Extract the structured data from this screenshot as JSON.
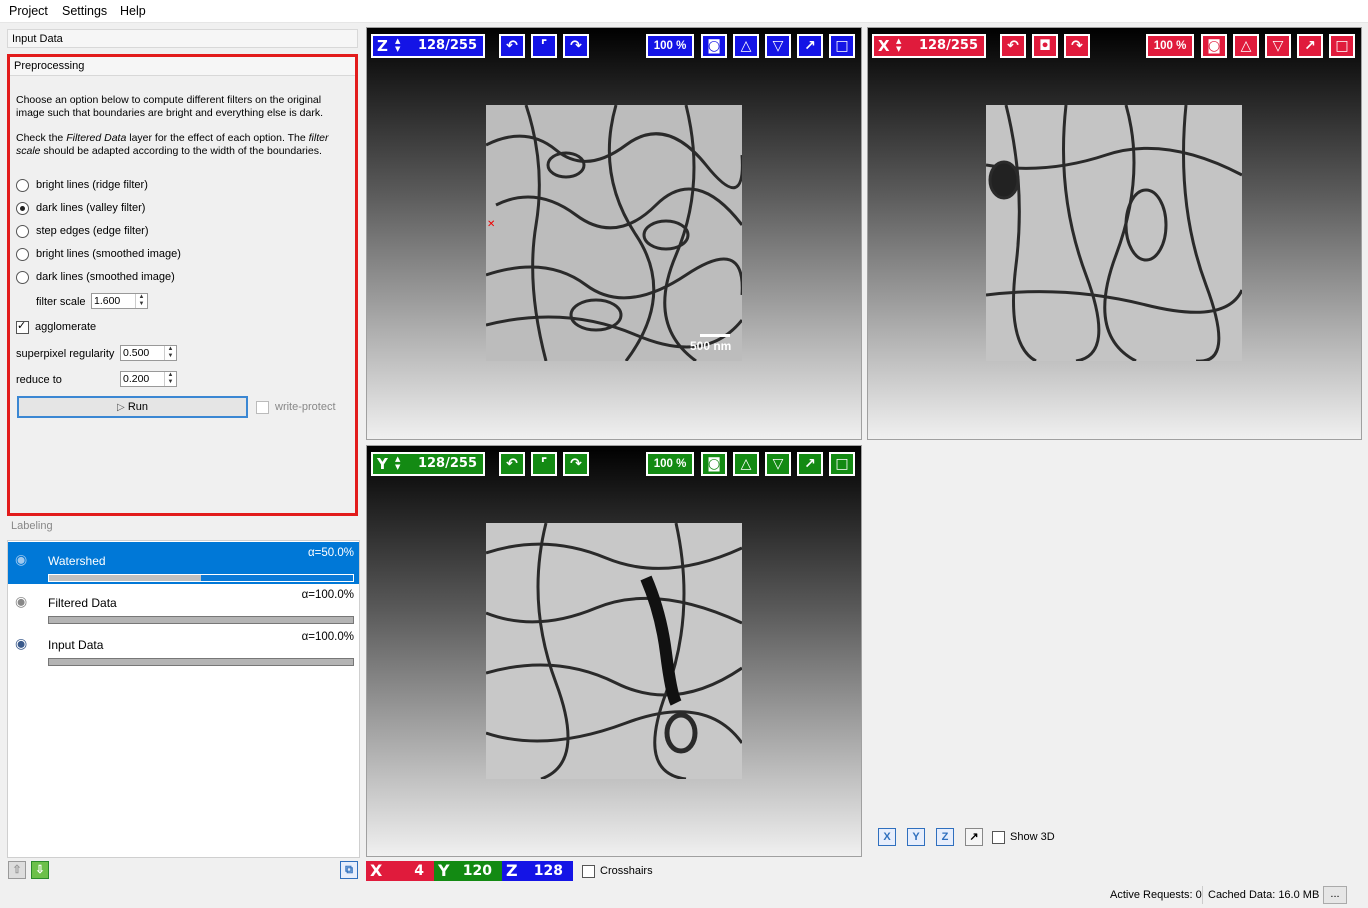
{
  "menu": [
    "Project",
    "Settings",
    "Help"
  ],
  "sections": {
    "input_data": "Input Data",
    "preprocessing": "Preprocessing",
    "labeling": "Labeling"
  },
  "preprocessing": {
    "desc1": "Choose an option below to compute different filters on the original image such that boundaries are bright and everything else is dark.",
    "desc2_a": "Check the ",
    "desc2_em1": "Filtered Data",
    "desc2_b": " layer for the effect of each option. The ",
    "desc2_em2": "filter scale",
    "desc2_c": " should be adapted according to the width of the boundaries.",
    "options": [
      {
        "label": "bright lines (ridge filter)",
        "checked": false
      },
      {
        "label": "dark lines (valley filter)",
        "checked": true
      },
      {
        "label": "step edges (edge filter)",
        "checked": false
      },
      {
        "label": "bright lines (smoothed image)",
        "checked": false
      },
      {
        "label": "dark lines (smoothed image)",
        "checked": false
      }
    ],
    "filter_scale_label": "filter scale",
    "filter_scale": "1.600",
    "agglomerate_label": "agglomerate",
    "superpixel_label": "superpixel regularity",
    "superpixel_value": "0.500",
    "reduce_label": "reduce to",
    "reduce_value": "0.200",
    "run_label": "Run",
    "write_protect_label": "write-protect"
  },
  "layers": [
    {
      "name": "Watershed",
      "alpha": "α=50.0%",
      "opacity": 0.5,
      "selected": true
    },
    {
      "name": "Filtered Data",
      "alpha": "α=100.0%",
      "opacity": 1.0,
      "selected": false
    },
    {
      "name": "Input Data",
      "alpha": "α=100.0%",
      "opacity": 1.0,
      "selected": false
    }
  ],
  "viewers": {
    "z": {
      "axis": "Z",
      "position": "128/255",
      "zoom": "100 %",
      "color": "#1414e6"
    },
    "x": {
      "axis": "X",
      "position": "128/255",
      "zoom": "100 %",
      "color": "#e01b3c"
    },
    "y": {
      "axis": "Y",
      "position": "128/255",
      "zoom": "100 %",
      "color": "#138a13"
    }
  },
  "scalebar": "500 nm",
  "coords": {
    "x_axis": "X",
    "x": "4",
    "y_axis": "Y",
    "y": "120",
    "z_axis": "Z",
    "z": "128"
  },
  "crosshairs_label": "Crosshairs",
  "view3d": {
    "x": "X",
    "y": "Y",
    "z": "Z",
    "show3d_label": "Show 3D"
  },
  "status": {
    "active_requests": "Active Requests: 0",
    "cached": "Cached Data: 16.0 MB",
    "more": "..."
  }
}
